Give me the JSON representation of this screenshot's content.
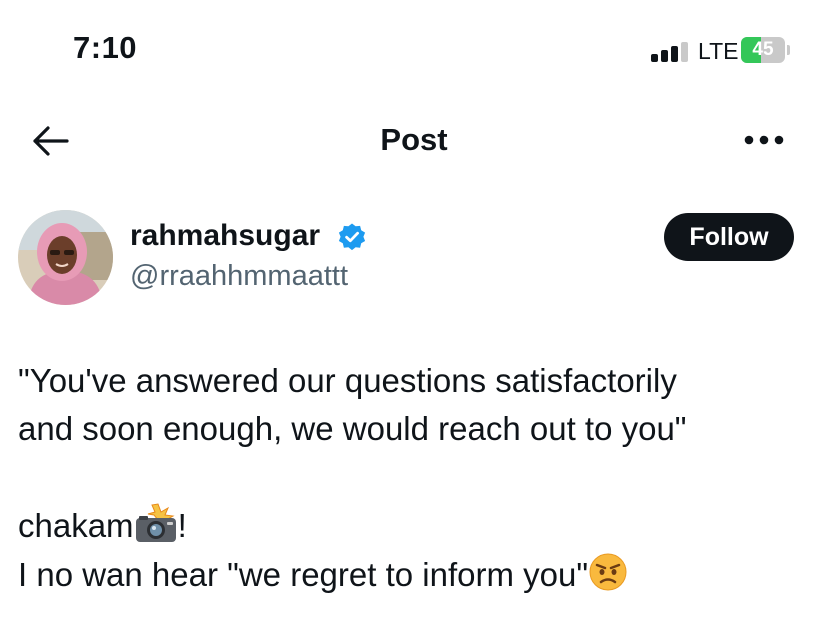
{
  "status_bar": {
    "time": "7:10",
    "network": "LTE",
    "battery_level": "45",
    "battery_percent": 45,
    "battery_color": "#34c759",
    "icons": [
      "signal-icon",
      "battery-icon"
    ]
  },
  "nav": {
    "title": "Post",
    "back_icon": "arrow-left-icon",
    "more_icon": "more-icon"
  },
  "author": {
    "display_name": "rahmahsugar",
    "handle": "@rraahhmmaattt",
    "verified_color": "#1d9bf0",
    "follow_label": "Follow"
  },
  "post": {
    "line1": "\"You've answered our questions satisfactorily",
    "line2": "and soon enough, we would reach out to you\"",
    "line3_text": "chakam",
    "line3_suffix": "!",
    "line4_text": "I no wan hear \"we regret to inform you\"",
    "emojis": [
      "camera-flash-icon",
      "angry-face-icon"
    ]
  }
}
